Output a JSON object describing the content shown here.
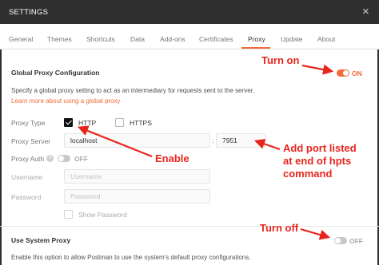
{
  "window": {
    "title": "SETTINGS",
    "close_glyph": "×"
  },
  "tabs": [
    {
      "label": "General"
    },
    {
      "label": "Themes"
    },
    {
      "label": "Shortcuts"
    },
    {
      "label": "Data"
    },
    {
      "label": "Add-ons"
    },
    {
      "label": "Certificates"
    },
    {
      "label": "Proxy",
      "active": true
    },
    {
      "label": "Update"
    },
    {
      "label": "About"
    }
  ],
  "global_proxy": {
    "title": "Global Proxy Configuration",
    "toggle_state": "ON",
    "toggle_on": true,
    "description": "Specify a global proxy setting to act as an intermediary for requests sent to the server.",
    "learn_more": "Learn more about using a global proxy",
    "proxy_type_label": "Proxy Type",
    "http_label": "HTTP",
    "http_checked": true,
    "https_label": "HTTPS",
    "https_checked": false,
    "proxy_server_label": "Proxy Server",
    "server_value": "localhost",
    "colon": ":",
    "port_value": "7951",
    "proxy_auth_label": "Proxy Auth",
    "proxy_auth_help": "?",
    "proxy_auth_state": "OFF",
    "proxy_auth_on": false,
    "username_label": "Username",
    "username_placeholder": "Username",
    "password_label": "Password",
    "password_placeholder": "Password",
    "show_password_label": "Show Password"
  },
  "system_proxy": {
    "title": "Use System Proxy",
    "toggle_state": "OFF",
    "toggle_on": false,
    "description": "Enable this option to allow Postman to use the system's default proxy configurations."
  },
  "annotations": {
    "turn_on": "Turn on",
    "enable": "Enable",
    "add_port": [
      "Add port listed",
      "at end of hpts",
      "command"
    ],
    "turn_off": "Turn off",
    "color": "#e8251d"
  },
  "colors": {
    "accent": "#f26b3a",
    "titlebar": "#2f2f2f",
    "annotation": "#e8251d"
  }
}
